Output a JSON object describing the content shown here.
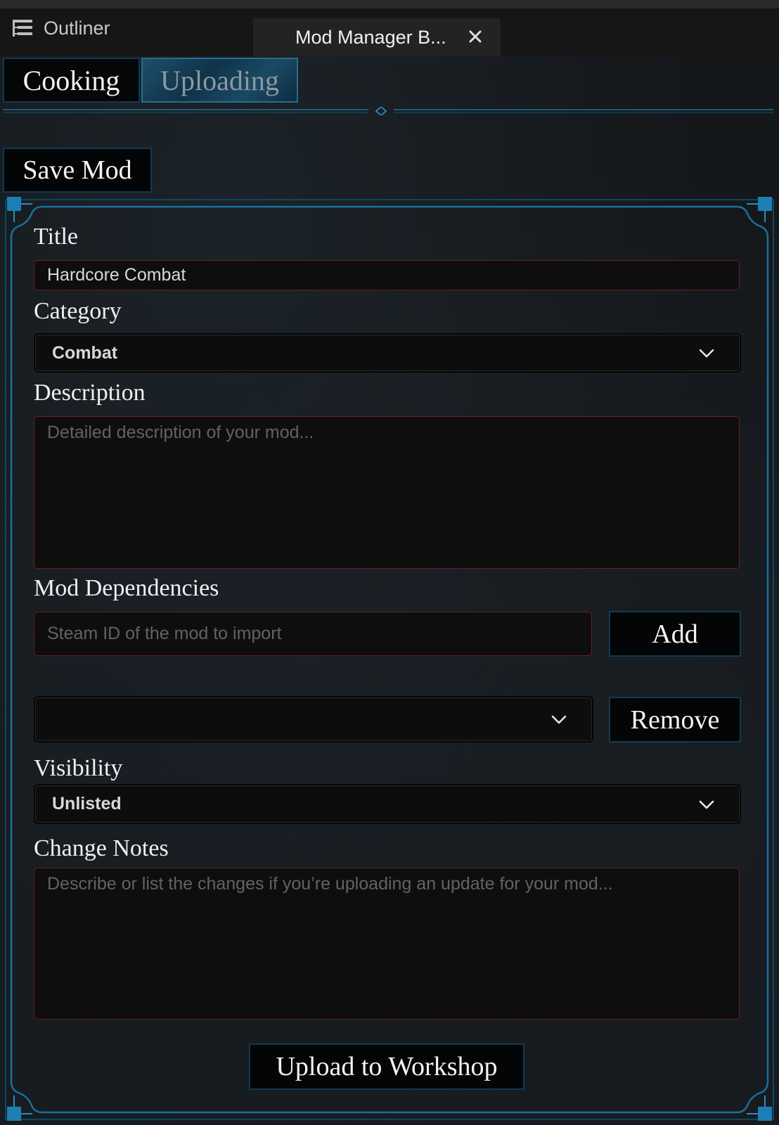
{
  "window": {
    "tabs": [
      {
        "label": "Outliner",
        "icon": "outliner-icon"
      },
      {
        "label": "Mod Manager B...",
        "icon": "close-icon"
      }
    ]
  },
  "subtabs": [
    {
      "label": "Cooking",
      "selected": false
    },
    {
      "label": "Uploading",
      "selected": true
    }
  ],
  "save_button": "Save Mod",
  "form": {
    "title_label": "Title",
    "title_value": "Hardcore Combat",
    "category_label": "Category",
    "category_value": "Combat",
    "description_label": "Description",
    "description_placeholder": "Detailed description of your mod...",
    "dependencies_label": "Mod Dependencies",
    "dependencies_placeholder": "Steam ID of the mod to import",
    "add_button": "Add",
    "dependency_select_value": "",
    "remove_button": "Remove",
    "visibility_label": "Visibility",
    "visibility_value": "Unlisted",
    "change_notes_label": "Change Notes",
    "change_notes_placeholder": "Describe or list the changes if you’re uploading an update for your mod...",
    "upload_button": "Upload to Workshop"
  },
  "colors": {
    "accent": "#1b6f9e",
    "field_border": "#6a1e22",
    "background": "#15181b"
  }
}
